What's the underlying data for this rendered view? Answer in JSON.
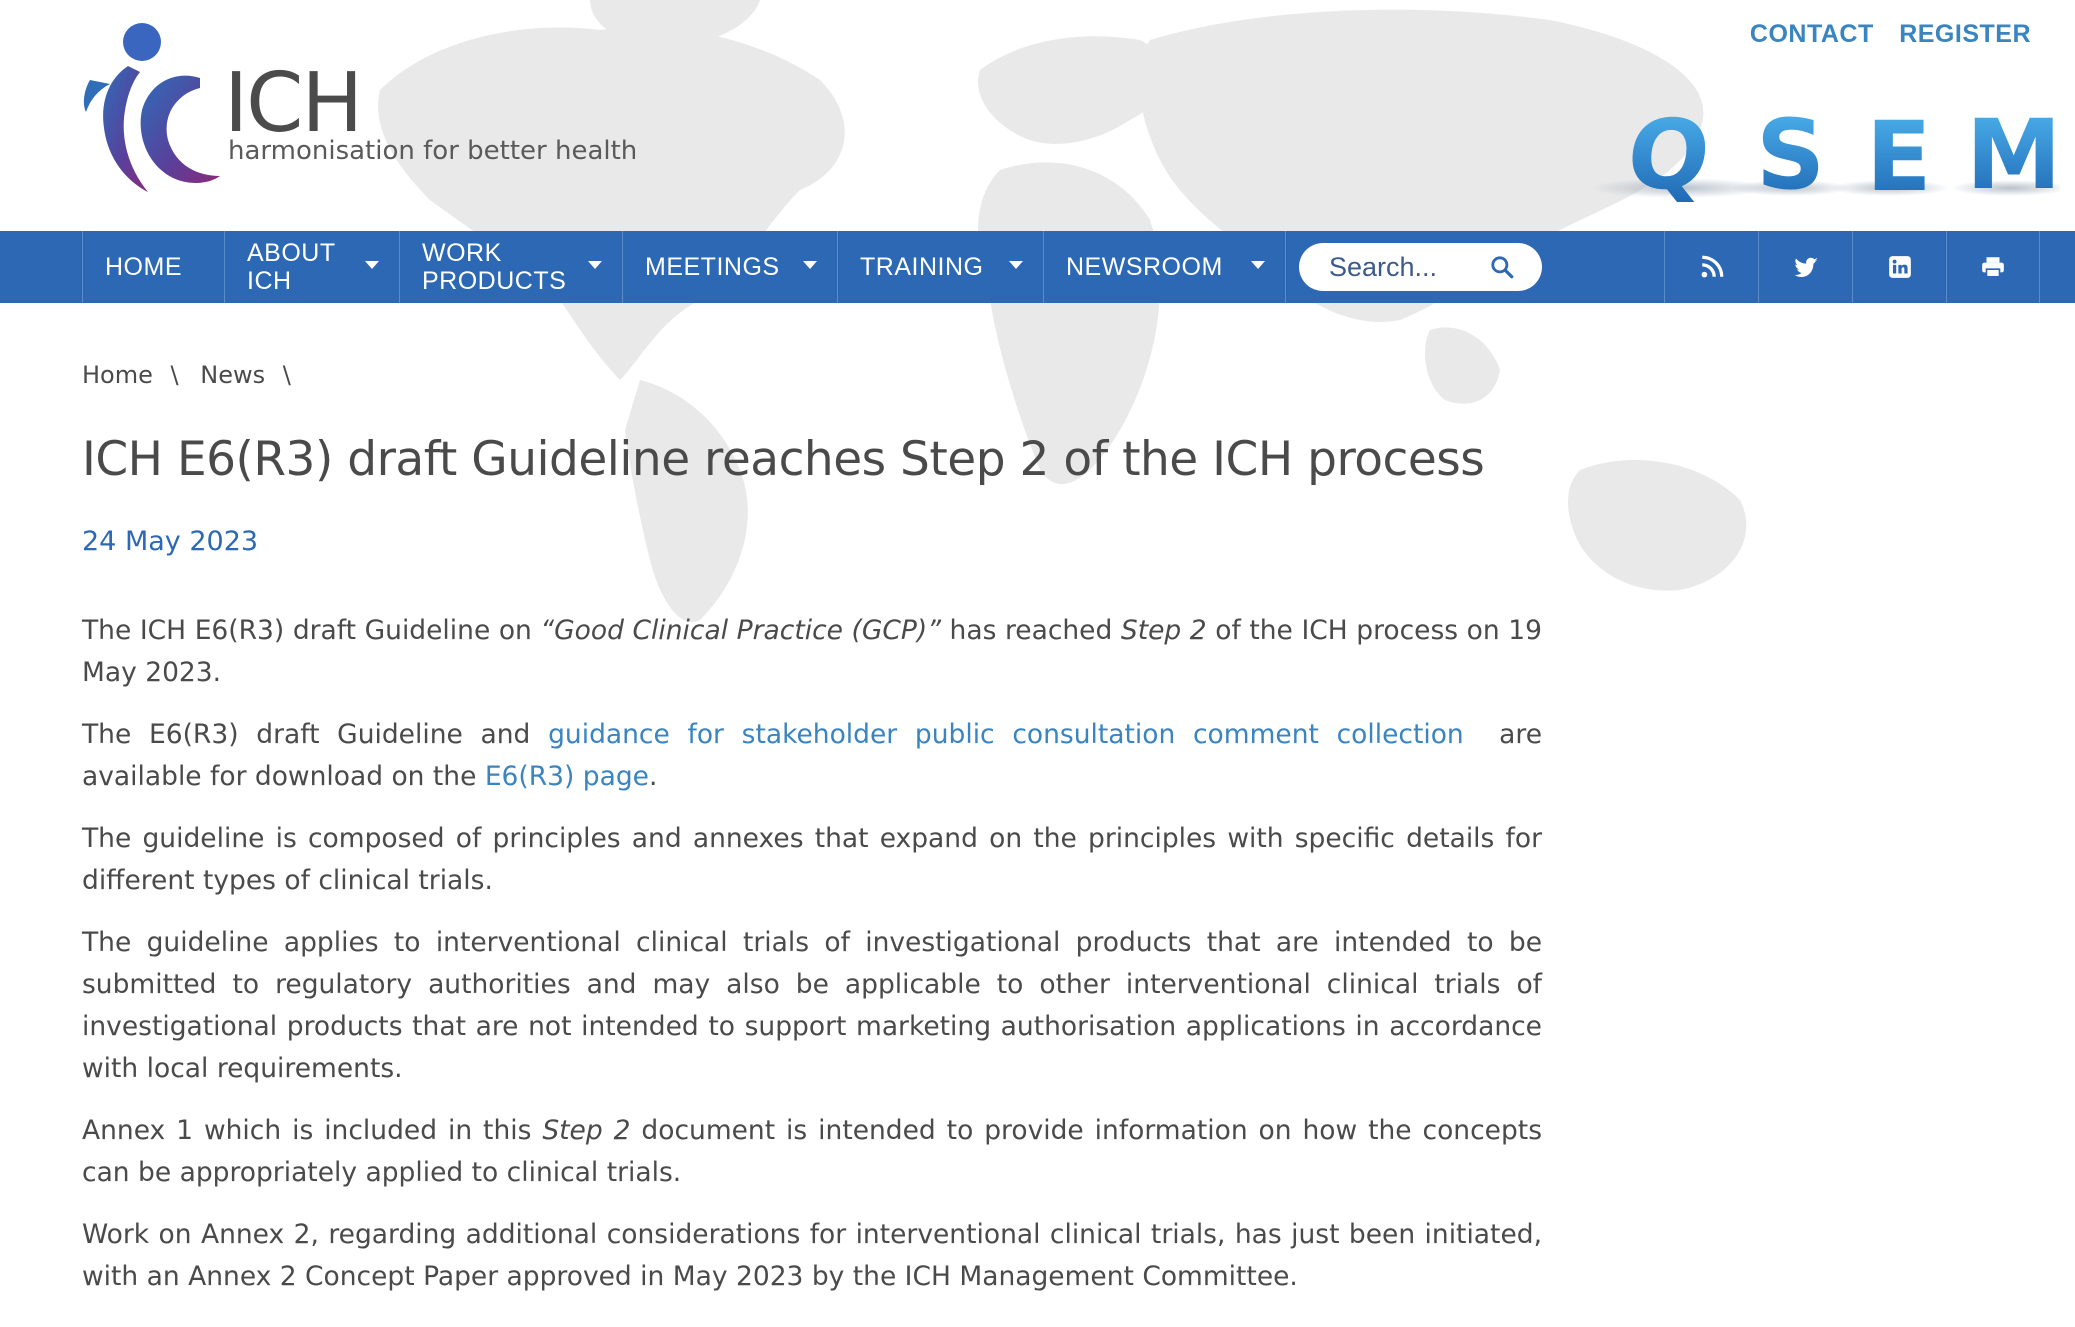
{
  "header": {
    "logo_text": "ICH",
    "logo_tagline": "harmonisation for better health",
    "top_links": [
      {
        "label": "CONTACT"
      },
      {
        "label": "REGISTER"
      }
    ],
    "banner_letters": [
      "Q",
      "S",
      "E",
      "M"
    ]
  },
  "nav": {
    "items": [
      {
        "label": "HOME",
        "has_dropdown": false
      },
      {
        "label": "ABOUT ICH",
        "has_dropdown": true
      },
      {
        "label": "WORK PRODUCTS",
        "has_dropdown": true
      },
      {
        "label": "MEETINGS",
        "has_dropdown": true
      },
      {
        "label": "TRAINING",
        "has_dropdown": true
      },
      {
        "label": "NEWSROOM",
        "has_dropdown": true
      }
    ],
    "search_placeholder": "Search...",
    "social_icons": [
      "rss-icon",
      "twitter-icon",
      "linkedin-icon",
      "print-icon"
    ]
  },
  "breadcrumb": {
    "items": [
      "Home",
      "News"
    ],
    "separator": "\\"
  },
  "article": {
    "title": "ICH E6(R3) draft Guideline reaches Step 2 of the ICH process",
    "date": "24 May 2023",
    "p1": {
      "a": "The ICH E6(R3) draft Guideline on ",
      "em1": "“Good Clinical Practice (GCP)”",
      "b": " has reached ",
      "em2": "Step 2",
      "c": " of the ICH process on 19 May 2023."
    },
    "p2": {
      "a": "The E6(R3) draft Guideline and ",
      "link1": "guidance for stakeholder public consultation comment collection",
      "b": "  are available for download on the ",
      "link2": "E6(R3) page",
      "c": "."
    },
    "p3": "The guideline is composed of principles and annexes that expand on the principles with specific details for different types of clinical trials.",
    "p4": "The guideline applies to interventional clinical trials of investigational products that are intended to be submitted to regulatory authorities and may also be applicable to other interventional clinical trials of investigational products that are not intended to support marketing authorisation applications in accordance with local requirements.",
    "p5": {
      "a": "Annex 1 which is included in this ",
      "em": "Step 2",
      "b": " document is intended to provide information on how the concepts can be appropriately applied to clinical trials."
    },
    "p6": "Work on Annex 2, regarding additional considerations for interventional clinical trials, has just been initiated, with an Annex 2 Concept Paper approved in May 2023 by the ICH Management Committee."
  },
  "colors": {
    "nav_bg": "#2c68b4",
    "link": "#3a84c0",
    "text": "#4a4a4a",
    "date": "#2c68b4"
  }
}
